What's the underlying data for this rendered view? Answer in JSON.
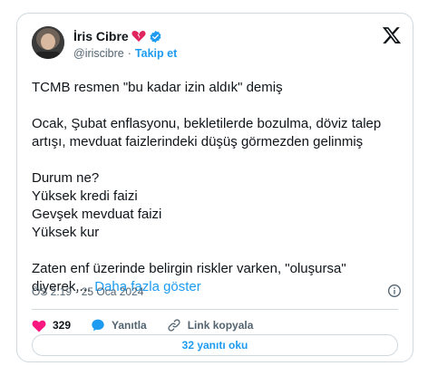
{
  "author": {
    "name": "İris Cibre",
    "handle": "@iriscibre",
    "separator": "·",
    "follow_label": "Takip et"
  },
  "tweet": {
    "paragraphs": [
      "TCMB resmen \"bu kadar izin aldık\" demiş",
      "Ocak, Şubat enflasyonu, bekletilerde bozulma, döviz talep\nartışı, mevduat faizlerindeki düşüş görmezden gelinmiş",
      "Durum ne?\nYüksek kredi faizi\nGevşek mevduat faizi\nYüksek kur"
    ],
    "last_paragraph": "Zaten enf üzerinde belirgin riskler varken, \"oluşursa\"\ndiyerek,...",
    "show_more": "Daha fazla göster",
    "timestamp": "ÖS 2:19 · 25 Oca 2024"
  },
  "actions": {
    "like_count": "329",
    "reply_label": "Yanıtla",
    "copy_link_label": "Link kopyala"
  },
  "replies_button": "32 yanıtı oku",
  "colors": {
    "accent": "#1d9bf0",
    "like": "#f91880",
    "text": "#0f1419",
    "muted": "#536471",
    "border": "#cfd9de"
  }
}
